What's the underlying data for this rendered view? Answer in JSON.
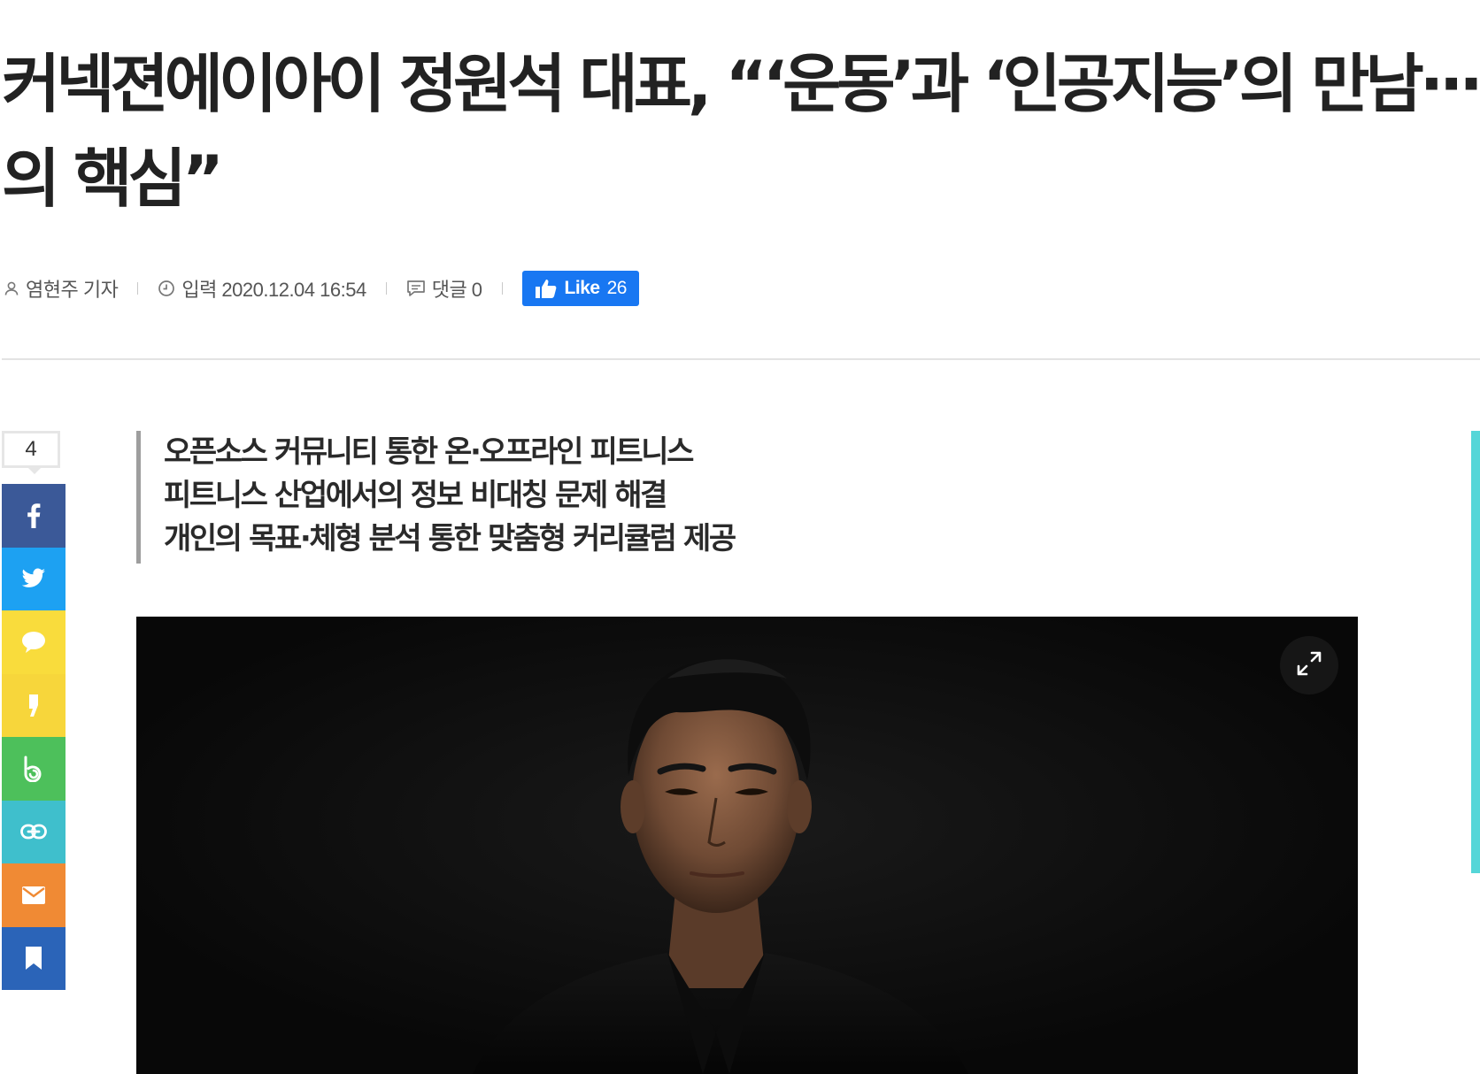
{
  "article": {
    "title": "커넥젼에이아이 정원석 대표, “‘운동’과 ‘인공지능’의 만남···삶의 핵심”",
    "reporter": "염현주 기자",
    "published": "입력 2020.12.04 16:54",
    "comments": "댓글 0",
    "facebook": {
      "label": "Like",
      "count": "26",
      "color": "#1877f2"
    },
    "subheads": [
      "오픈소스 커뮤니티 통한 온·오프라인 피트니스",
      "피트니스 산업에서의 정보 비대칭 문제 해결",
      "개인의 목표·체형 분석 통한 맞춤형 커리큘럼 제공"
    ]
  },
  "share": {
    "count": "4",
    "buttons": [
      {
        "name": "facebook",
        "icon": "facebook-icon",
        "color": "#3b5998"
      },
      {
        "name": "twitter",
        "icon": "twitter-icon",
        "color": "#1da1f2"
      },
      {
        "name": "kakaotalk",
        "icon": "speech-bubble-icon",
        "color": "#f9dc3c"
      },
      {
        "name": "kakaostory",
        "icon": "kakaostory-icon",
        "color": "#f7d63b"
      },
      {
        "name": "band",
        "icon": "band-icon",
        "color": "#4dc05b"
      },
      {
        "name": "link",
        "icon": "link-icon",
        "color": "#3fbfcc"
      },
      {
        "name": "email",
        "icon": "mail-icon",
        "color": "#f08a34"
      },
      {
        "name": "bookmark",
        "icon": "bookmark-icon",
        "color": "#2b64b8"
      }
    ]
  },
  "photo": {
    "expand_icon": "expand-icon",
    "background": "#0b0b0b"
  },
  "accent_color": "#55d6d8"
}
